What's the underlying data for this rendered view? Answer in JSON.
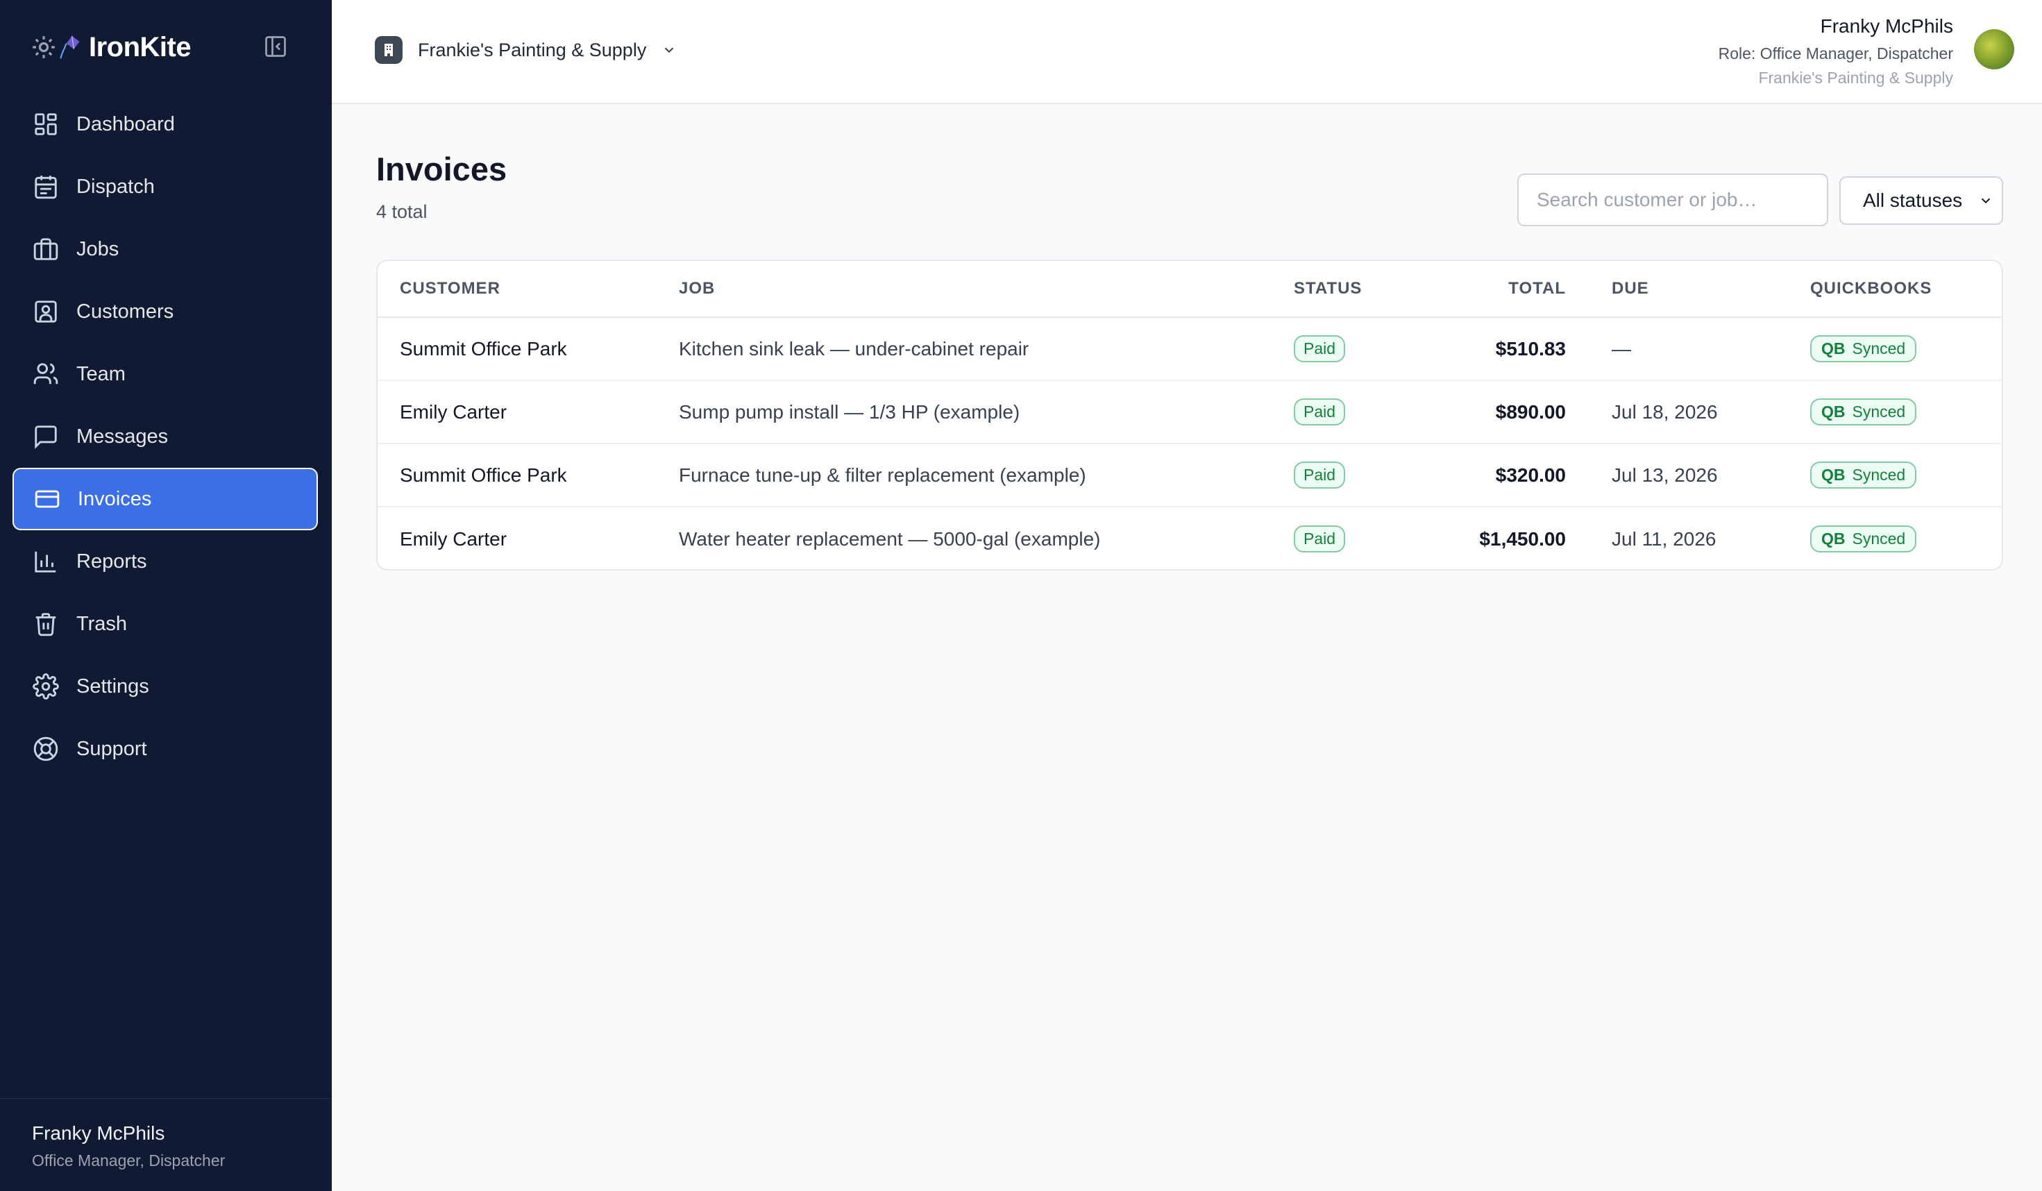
{
  "app": {
    "brand": "IronKite"
  },
  "sidebar": {
    "items": [
      {
        "label": "Dashboard",
        "icon": "dashboard-icon"
      },
      {
        "label": "Dispatch",
        "icon": "calendar-icon"
      },
      {
        "label": "Jobs",
        "icon": "briefcase-icon"
      },
      {
        "label": "Customers",
        "icon": "contact-card-icon"
      },
      {
        "label": "Team",
        "icon": "users-icon"
      },
      {
        "label": "Messages",
        "icon": "message-icon"
      },
      {
        "label": "Invoices",
        "icon": "credit-card-icon",
        "active": true
      },
      {
        "label": "Reports",
        "icon": "bar-chart-icon"
      },
      {
        "label": "Trash",
        "icon": "trash-icon"
      },
      {
        "label": "Settings",
        "icon": "gear-icon"
      },
      {
        "label": "Support",
        "icon": "lifebuoy-icon"
      }
    ],
    "footer": {
      "name": "Franky McPhils",
      "role": "Office Manager, Dispatcher"
    }
  },
  "topbar": {
    "company": "Frankie's Painting & Supply",
    "user": {
      "name": "Franky McPhils",
      "role": "Role: Office Manager, Dispatcher",
      "company": "Frankie's Painting & Supply"
    }
  },
  "page": {
    "title": "Invoices",
    "count": "4 total",
    "search_placeholder": "Search customer or job…",
    "status_filter": "All statuses"
  },
  "table": {
    "columns": {
      "customer": "CUSTOMER",
      "job": "JOB",
      "status": "STATUS",
      "total": "TOTAL",
      "due": "DUE",
      "quickbooks": "QUICKBOOKS"
    },
    "rows": [
      {
        "customer": "Summit Office Park",
        "job": "Kitchen sink leak — under-cabinet repair",
        "status": "Paid",
        "total": "$510.83",
        "due": "—",
        "qb_tag": "QB",
        "qb_status": "Synced"
      },
      {
        "customer": "Emily Carter",
        "job": "Sump pump install — 1/3 HP (example)",
        "status": "Paid",
        "total": "$890.00",
        "due": "Jul 18, 2026",
        "qb_tag": "QB",
        "qb_status": "Synced"
      },
      {
        "customer": "Summit Office Park",
        "job": "Furnace tune-up & filter replacement (example)",
        "status": "Paid",
        "total": "$320.00",
        "due": "Jul 13, 2026",
        "qb_tag": "QB",
        "qb_status": "Synced"
      },
      {
        "customer": "Emily Carter",
        "job": "Water heater replacement — 5000-gal (example)",
        "status": "Paid",
        "total": "$1,450.00",
        "due": "Jul 11, 2026",
        "qb_tag": "QB",
        "qb_status": "Synced"
      }
    ]
  },
  "colors": {
    "sidebar_bg": "#111a33",
    "accent": "#3b6fe6",
    "paid_green": "#15803d"
  }
}
